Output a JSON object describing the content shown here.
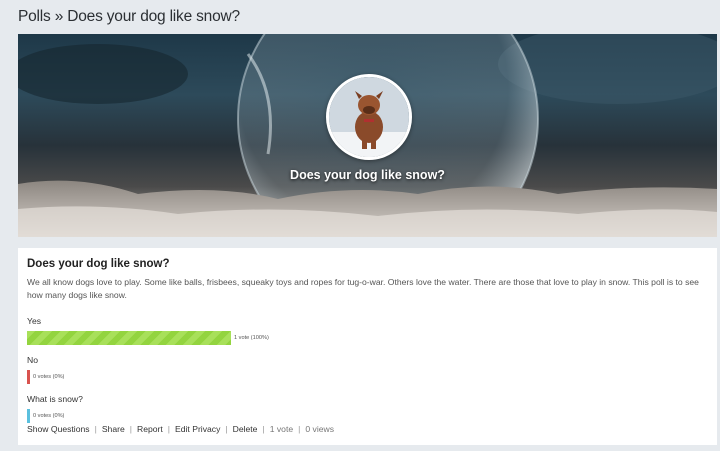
{
  "breadcrumb": {
    "section": "Polls",
    "separator": "»",
    "current": "Does your dog like snow?"
  },
  "hero": {
    "title": "Does your dog like snow?"
  },
  "poll": {
    "title": "Does your dog like snow?",
    "description": "We all know dogs love to play. Some like balls, frisbees, squeaky toys and ropes for tug-o-war. Others love the water. There are those that love to play in snow. This poll is to see how many dogs like snow.",
    "options": [
      {
        "label": "Yes",
        "votes_text": "1 vote (100%)",
        "percent": 100,
        "color": "#9bd94a"
      },
      {
        "label": "No",
        "votes_text": "0 votes (0%)",
        "percent": 0,
        "color": "#d9534f"
      },
      {
        "label": "What is snow?",
        "votes_text": "0 votes (0%)",
        "percent": 0,
        "color": "#5bc0de"
      }
    ]
  },
  "actions": {
    "show_questions": "Show Questions",
    "share": "Share",
    "report": "Report",
    "edit_privacy": "Edit Privacy",
    "delete": "Delete",
    "votes": "1 vote",
    "views": "0 views",
    "separator": "|"
  }
}
